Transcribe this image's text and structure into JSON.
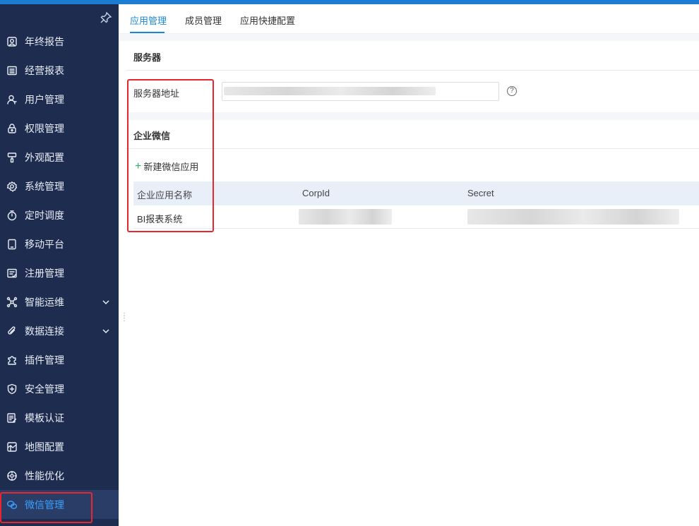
{
  "sidebar": {
    "items": [
      {
        "label": "年终报告",
        "icon": "report-icon"
      },
      {
        "label": "经营报表",
        "icon": "list-icon"
      },
      {
        "label": "用户管理",
        "icon": "user-icon"
      },
      {
        "label": "权限管理",
        "icon": "lock-icon"
      },
      {
        "label": "外观配置",
        "icon": "brush-icon"
      },
      {
        "label": "系统管理",
        "icon": "gear-icon"
      },
      {
        "label": "定时调度",
        "icon": "timer-icon"
      },
      {
        "label": "移动平台",
        "icon": "mobile-icon"
      },
      {
        "label": "注册管理",
        "icon": "register-icon"
      },
      {
        "label": "智能运维",
        "icon": "network-icon",
        "expandable": true
      },
      {
        "label": "数据连接",
        "icon": "paperclip-icon",
        "expandable": true
      },
      {
        "label": "插件管理",
        "icon": "puzzle-icon"
      },
      {
        "label": "安全管理",
        "icon": "shield-icon"
      },
      {
        "label": "模板认证",
        "icon": "template-icon"
      },
      {
        "label": "地图配置",
        "icon": "map-icon"
      },
      {
        "label": "性能优化",
        "icon": "performance-icon"
      },
      {
        "label": "微信管理",
        "icon": "wechat-icon",
        "active": true
      }
    ]
  },
  "tabs": [
    {
      "label": "应用管理",
      "active": true
    },
    {
      "label": "成员管理"
    },
    {
      "label": "应用快捷配置"
    }
  ],
  "server_section": {
    "title": "服务器",
    "field_label": "服务器地址",
    "help_glyph": "?"
  },
  "wechat_section": {
    "title": "企业微信",
    "add_button": "新建微信应用",
    "table": {
      "headers": [
        "企业应用名称",
        "CorpId",
        "Secret"
      ],
      "rows": [
        {
          "name": "BI报表系统"
        }
      ]
    }
  },
  "colors": {
    "sidebar_bg": "#1e2d4f",
    "accent": "#1b88d8",
    "active_text": "#3aa0ff",
    "highlight": "#e8262e"
  }
}
